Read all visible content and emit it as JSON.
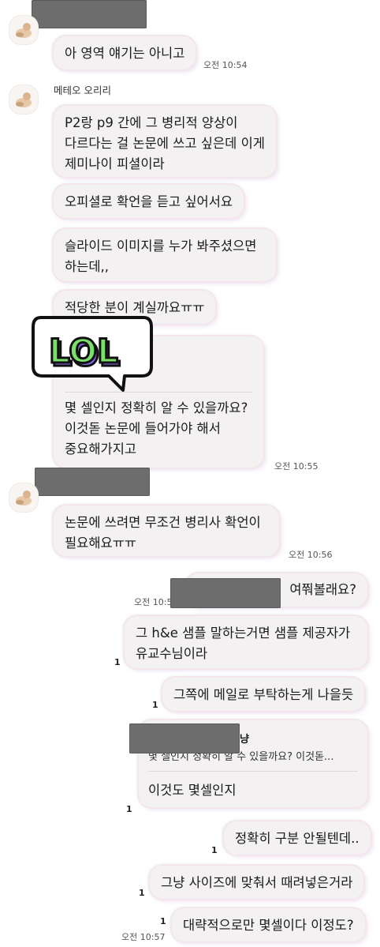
{
  "chat": {
    "received": [
      {
        "text": "아 영역 얘기는 아니고",
        "time": "오전 10:54"
      },
      {
        "sender": "메테오 오리리"
      },
      {
        "lines": [
          "P2랑 p9 간에 그 병리적 양상이",
          "다르다는 걸 논문에 쓰고 싶은데 이게",
          "제미나이 피셜이라"
        ]
      },
      {
        "text": "오피셜로 확언을 듣고 싶어서요"
      },
      {
        "lines": [
          "슬라이드 이미지를 누가 봐주셨으면",
          "하는데,,"
        ]
      },
      {
        "text": "적당한 분이 계실까요ㅠㅠ"
      },
      {
        "sticker": "LOL"
      },
      {
        "lines": [
          "몇 셀인지 정확히 알 수 있을까요?",
          "이것돋 논문에 들어가야 해서",
          "중요해가지고"
        ],
        "time": "오전 10:55"
      },
      {
        "lines": [
          "논문에 쓰려면 무조건 병리사 확언이",
          "필요해요ㅠㅠ"
        ],
        "time": "오전 10:56"
      }
    ],
    "sent": [
      {
        "text_tail": "여쭤볼래요?",
        "time": "오전 10:5"
      },
      {
        "lines": [
          "그 h&e 샘플 말하는거면 샘플 제공자가",
          "유교수님이라"
        ],
        "unread": "1"
      },
      {
        "text": "그쪽에 메일로 부탁하는게 나을듯",
        "unread": "1"
      },
      {
        "reply_name_tail": "냥",
        "quote": "몇 셀인지 정확히 알 수 있을까요? 이것돋...",
        "text": "이것도 몇셀인지",
        "unread": "1"
      },
      {
        "text": "정확히 구분 안될텐데..",
        "unread": "1"
      },
      {
        "text": "그냥 사이즈에 맞춰서 때려넣은거라",
        "unread": "1"
      },
      {
        "text": "대략적으로만 몇셀이다 이정도?",
        "unread": "1",
        "time": "오전 10:57"
      }
    ]
  },
  "icons": {
    "avatar": "duck-avatar-icon",
    "sticker": "lol-speech-bubble-sticker"
  },
  "colors": {
    "bubble": "#f3f1f1",
    "sticker_green": "#7be06a",
    "sticker_purple": "#8d6cf0",
    "redaction": "#6d6d6d"
  }
}
